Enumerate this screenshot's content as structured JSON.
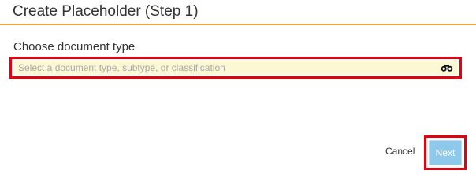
{
  "dialog": {
    "title": "Create Placeholder (Step 1)"
  },
  "document_type": {
    "label": "Choose document type",
    "value": "",
    "placeholder": "Select a document type, subtype, or classification",
    "search_icon": "binoculars-icon"
  },
  "footer": {
    "cancel_label": "Cancel",
    "next_label": "Next"
  },
  "colors": {
    "header_accent": "#f0a43a",
    "field_background": "#fcf8d4",
    "highlight_outline": "#e3000f",
    "next_button": "#8ec8ea"
  }
}
